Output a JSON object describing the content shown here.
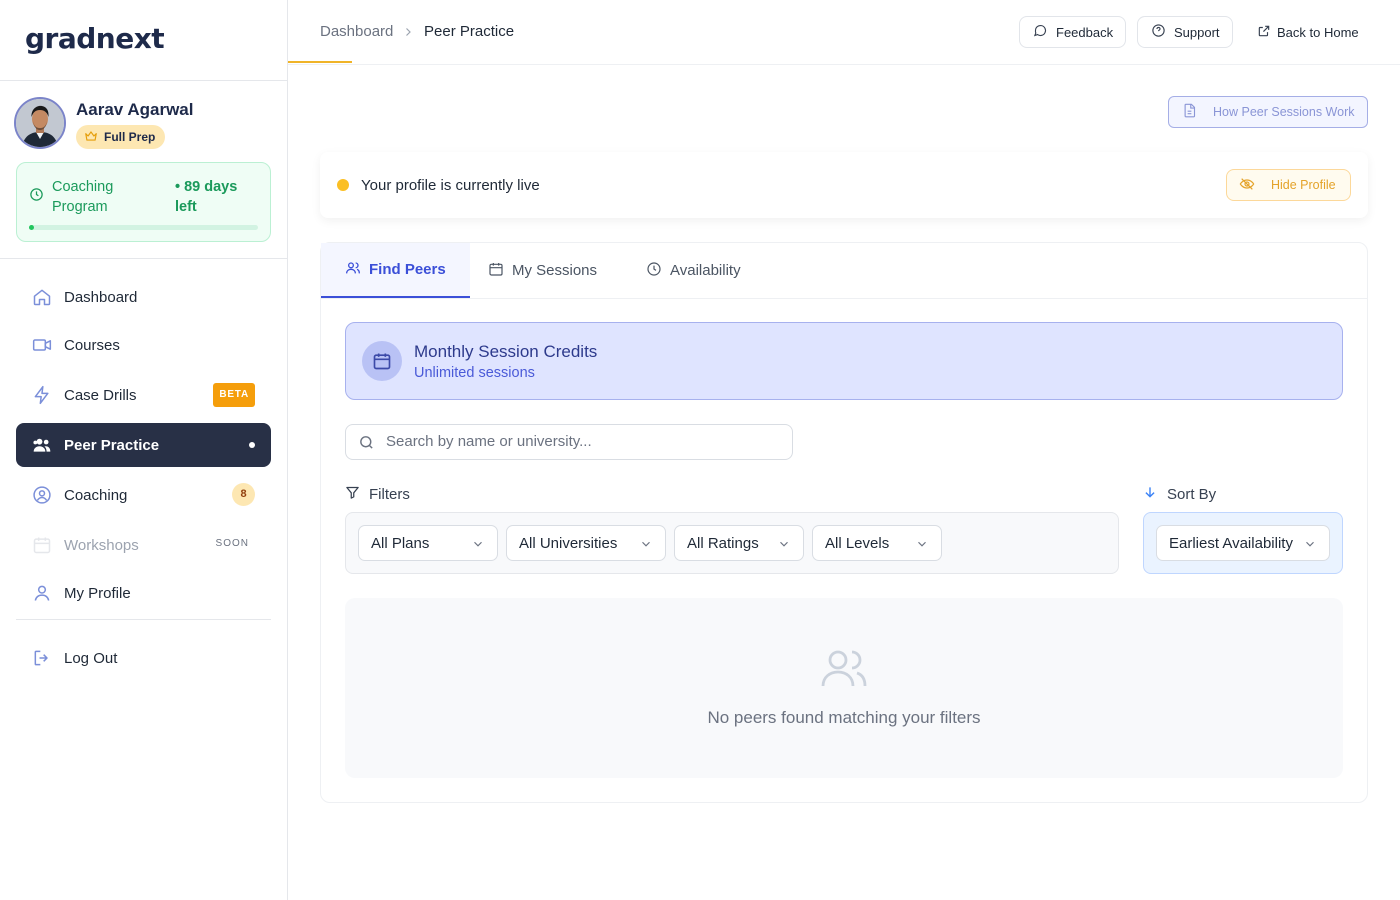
{
  "brand": {
    "logo_text": "gradnext"
  },
  "user": {
    "name": "Aarav Agarwal",
    "plan_badge": "Full Prep",
    "coaching": {
      "label": "Coaching Program",
      "days_left": "• 89 days left",
      "progress": 0.02
    }
  },
  "sidebar": {
    "items": [
      {
        "label": "Dashboard",
        "icon": "home-icon"
      },
      {
        "label": "Courses",
        "icon": "video-icon"
      },
      {
        "label": "Case Drills",
        "icon": "bolt-icon",
        "badge": "BETA"
      },
      {
        "label": "Peer Practice",
        "icon": "users-icon",
        "active": true
      },
      {
        "label": "Coaching",
        "icon": "coaching-icon",
        "count": "8"
      },
      {
        "label": "Workshops",
        "icon": "calendar-icon",
        "tag": "SOON"
      },
      {
        "label": "My Profile",
        "icon": "user-icon"
      },
      {
        "label": "Log Out",
        "icon": "logout-icon"
      }
    ]
  },
  "breadcrumb": {
    "home": "Dashboard",
    "current": "Peer Practice"
  },
  "topbar": {
    "feedback": "Feedback",
    "support": "Support",
    "back_home": "Back to Home"
  },
  "main": {
    "how_button": "How Peer Sessions Work",
    "live_status": "Your profile is currently live",
    "hide_button": "Hide Profile",
    "tabs": [
      {
        "label": "Find Peers",
        "icon": "users-icon",
        "active": true
      },
      {
        "label": "My Sessions",
        "icon": "calendar-icon"
      },
      {
        "label": "Availability",
        "icon": "clock-icon"
      }
    ],
    "credits": {
      "title": "Monthly Session Credits",
      "subtitle": "Unlimited sessions"
    },
    "search": {
      "placeholder": "Search by name or university...",
      "value": ""
    },
    "filters": {
      "label": "Filters",
      "plans": "All Plans",
      "universities": "All Universities",
      "ratings": "All Ratings",
      "levels": "All Levels"
    },
    "sort": {
      "label": "Sort By",
      "value": "Earliest Availability"
    },
    "empty_message": "No peers found matching your filters"
  },
  "colors": {
    "accent": "#3b4fd8",
    "active_nav": "#283046",
    "live_dot": "#fbbf24",
    "coaching_green": "#1b9a5b",
    "beta": "#f59e0b"
  }
}
